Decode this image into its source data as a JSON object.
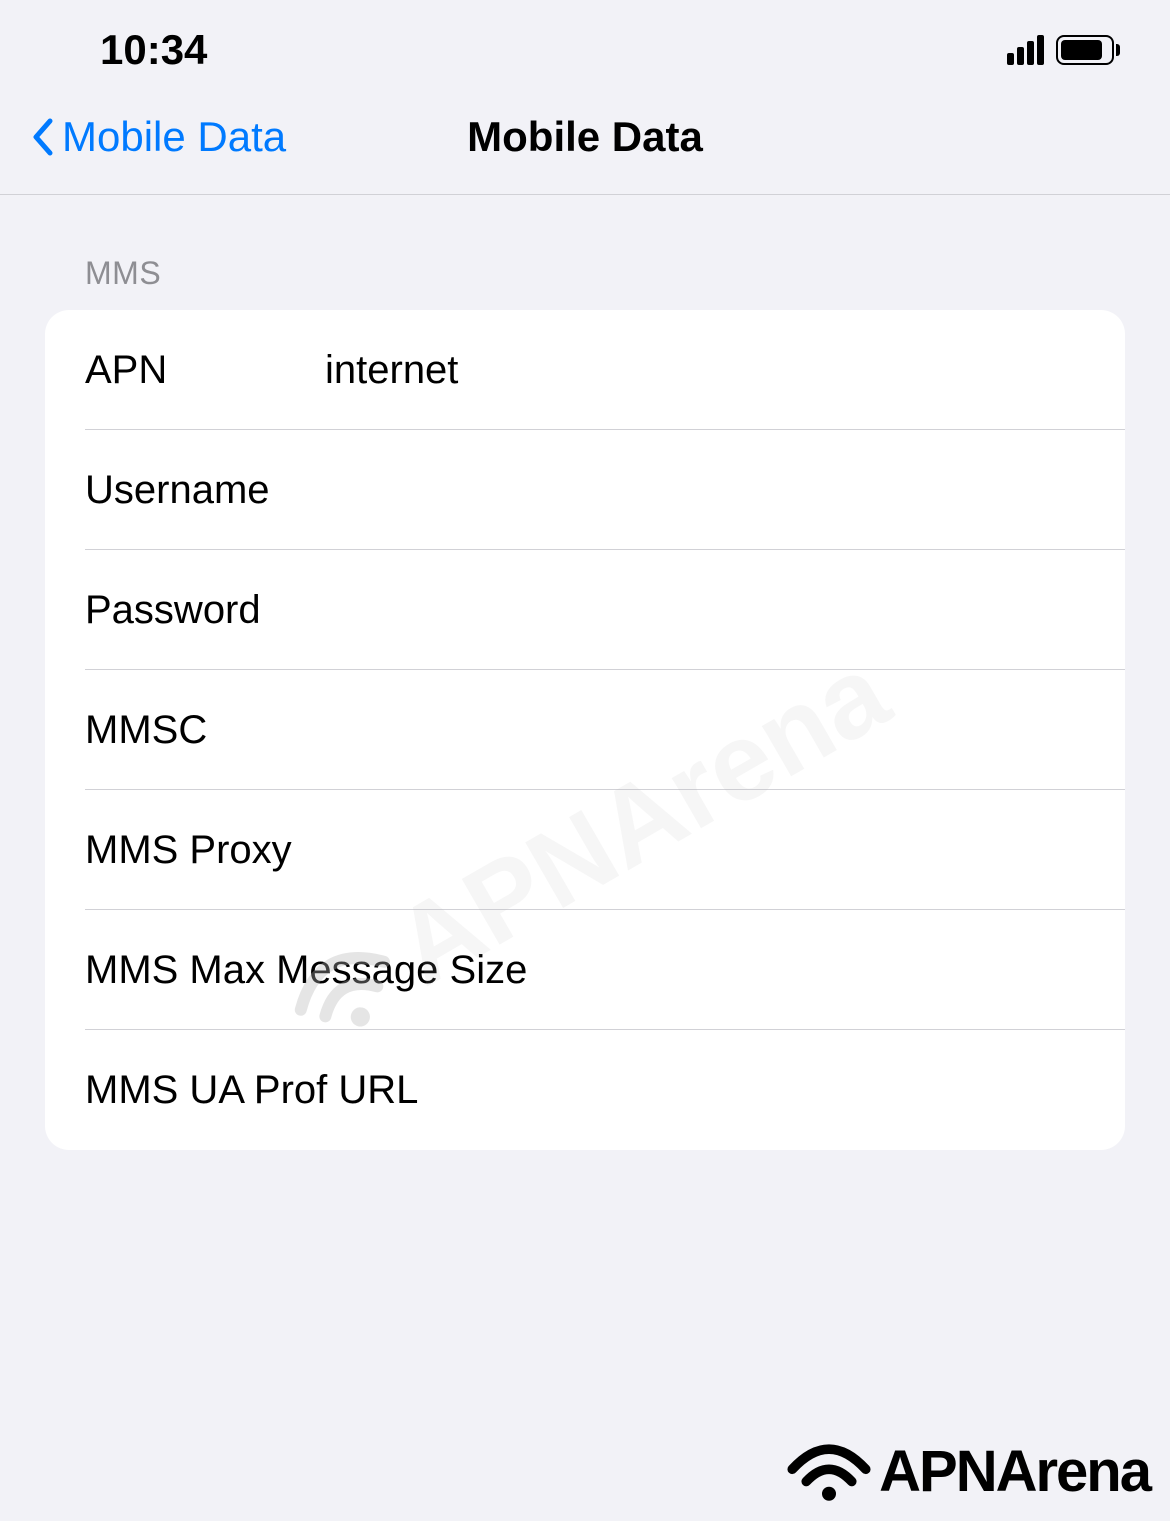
{
  "status": {
    "time": "10:34"
  },
  "nav": {
    "back_label": "Mobile Data",
    "title": "Mobile Data"
  },
  "section": {
    "header": "MMS"
  },
  "fields": {
    "apn": {
      "label": "APN",
      "value": "internet"
    },
    "username": {
      "label": "Username",
      "value": ""
    },
    "password": {
      "label": "Password",
      "value": ""
    },
    "mmsc": {
      "label": "MMSC",
      "value": ""
    },
    "mms_proxy": {
      "label": "MMS Proxy",
      "value": ""
    },
    "mms_max_size": {
      "label": "MMS Max Message Size",
      "value": ""
    },
    "mms_ua_prof": {
      "label": "MMS UA Prof URL",
      "value": ""
    }
  },
  "watermark": {
    "text": "APNArena"
  },
  "footer": {
    "text": "APNArena"
  }
}
